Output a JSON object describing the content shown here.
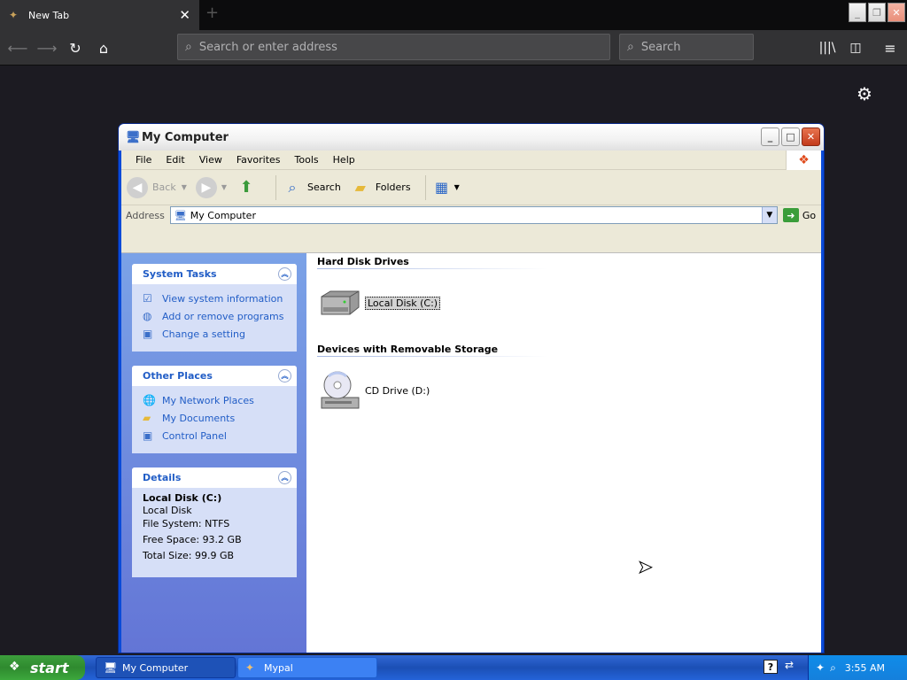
{
  "browser": {
    "tab_title": "New Tab",
    "tab_close": "✕",
    "new_tab": "+",
    "url_placeholder": "Search or enter address",
    "search_placeholder": "Search"
  },
  "window": {
    "title": "My Computer"
  },
  "menu": [
    "File",
    "Edit",
    "View",
    "Favorites",
    "Tools",
    "Help"
  ],
  "toolbar": {
    "back": "Back",
    "search": "Search",
    "folders": "Folders"
  },
  "address": {
    "label": "Address",
    "value": "My Computer",
    "go": "Go"
  },
  "system_tasks": {
    "title": "System Tasks",
    "items": [
      "View system information",
      "Add or remove programs",
      "Change a setting"
    ]
  },
  "other_places": {
    "title": "Other Places",
    "items": [
      "My Network Places",
      "My Documents",
      "Control Panel"
    ]
  },
  "details": {
    "title": "Details",
    "name": "Local Disk (C:)",
    "type": "Local Disk",
    "file_system": "File System: NTFS",
    "free_space": "Free Space: 93.2 GB",
    "total_size": "Total Size: 99.9 GB"
  },
  "groups": {
    "hard_disks": "Hard Disk Drives",
    "removable": "Devices with Removable Storage"
  },
  "drives": {
    "c": "Local Disk (C:)",
    "d": "CD Drive (D:)"
  },
  "taskbar": {
    "start": "start",
    "items": [
      "My Computer",
      "Mypal"
    ],
    "clock": "3:55 AM"
  }
}
